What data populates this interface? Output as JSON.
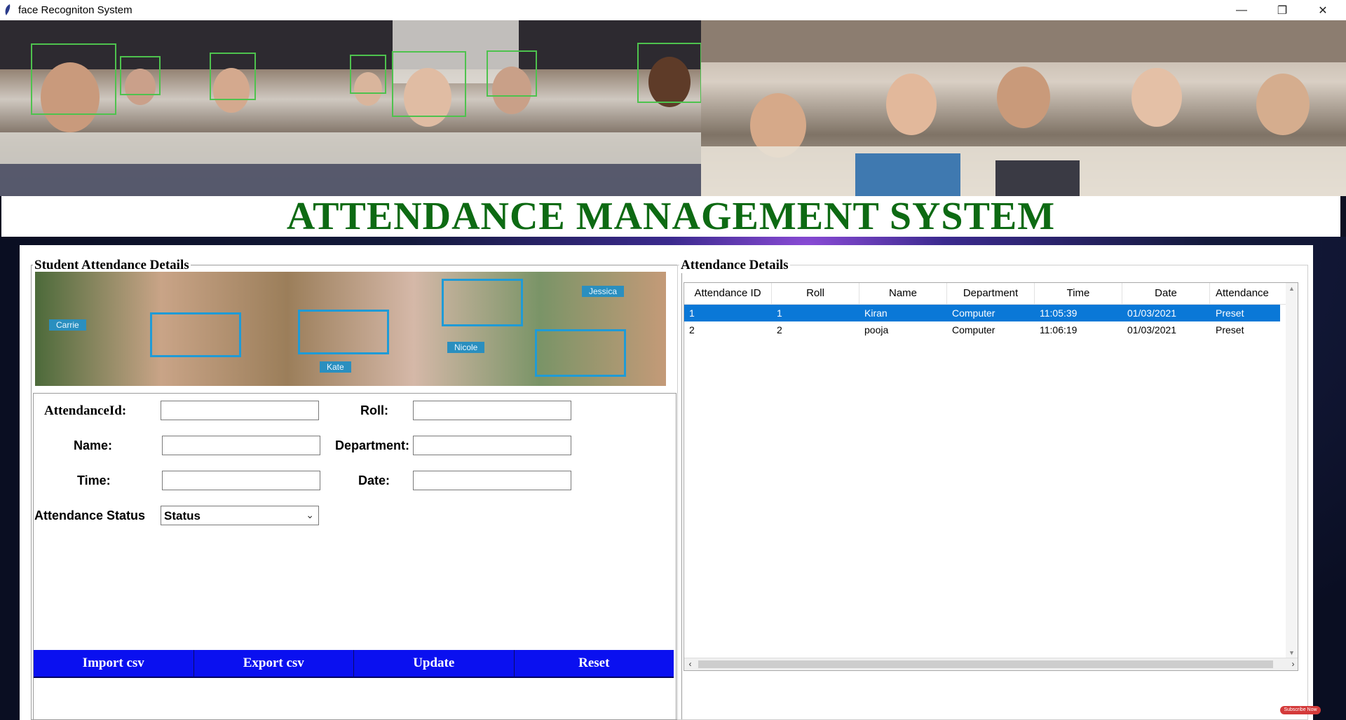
{
  "window": {
    "title": "face Recogniton System"
  },
  "heading": "ATTENDANCE MANAGEMENT SYSTEM",
  "left_panel": {
    "title": "Student Attendance Details",
    "face_tags": [
      "Jessica",
      "Carrie",
      "Nicole",
      "Kate"
    ],
    "form": {
      "attendance_id_label": "AttendanceId:",
      "roll_label": "Roll:",
      "name_label": "Name:",
      "department_label": "Department:",
      "time_label": "Time:",
      "date_label": "Date:",
      "status_label": "Attendance Status",
      "status_value": "Status",
      "attendance_id_value": "",
      "roll_value": "",
      "name_value": "",
      "department_value": "",
      "time_value": "",
      "date_value": ""
    },
    "buttons": {
      "import": "Import csv",
      "export": "Export csv",
      "update": "Update",
      "reset": "Reset"
    }
  },
  "right_panel": {
    "title": "Attendance Details",
    "columns": [
      "Attendance ID",
      "Roll",
      "Name",
      "Department",
      "Time",
      "Date",
      "Attendance"
    ],
    "rows": [
      [
        "1",
        "1",
        "Kiran",
        "Computer",
        "11:05:39",
        "01/03/2021",
        "Preset"
      ],
      [
        "2",
        "2",
        "pooja",
        "Computer",
        "11:06:19",
        "01/03/2021",
        "Preset"
      ]
    ],
    "selected_row": 0
  },
  "badge": "Subscribe Now",
  "colors": {
    "heading": "#0d6a13",
    "button_bg": "#0a10f0",
    "selection": "#0a78d7"
  }
}
